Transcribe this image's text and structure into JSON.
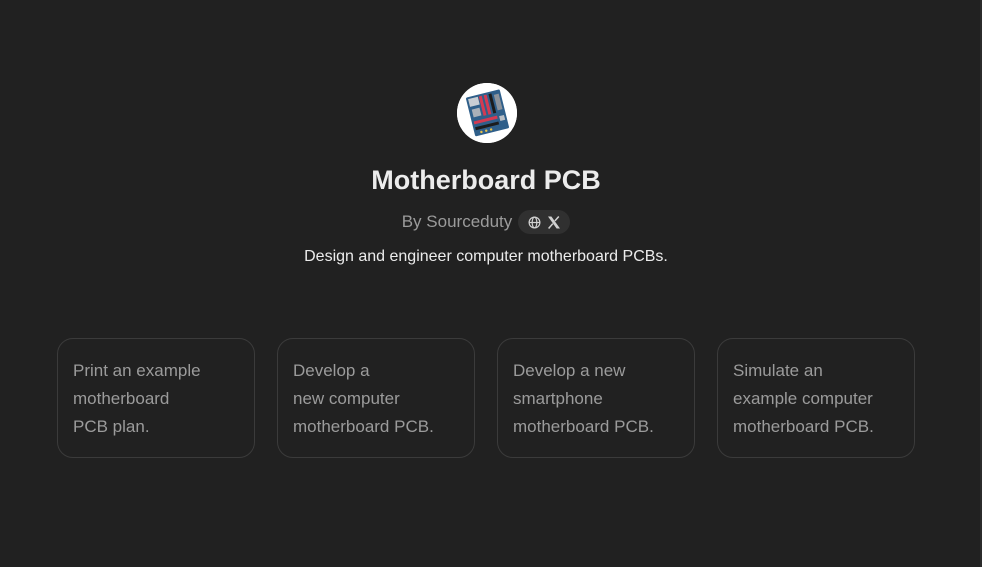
{
  "gpt": {
    "avatar_icon": "motherboard-image",
    "name": "Motherboard PCB",
    "author": "By Sourceduty",
    "links": [
      {
        "icon": "globe-icon"
      },
      {
        "icon": "x-logo-icon"
      }
    ],
    "description": "Design and engineer computer motherboard PCBs."
  },
  "conversation_starters": [
    {
      "text": "Print an example\nmotherboard\nPCB plan."
    },
    {
      "text": "Develop a\nnew computer\nmotherboard PCB."
    },
    {
      "text": "Develop a new\nsmartphone\nmotherboard PCB."
    },
    {
      "text": "Simulate an\nexample computer\nmotherboard PCB."
    }
  ],
  "colors": {
    "background": "#212121",
    "title": "#ececec",
    "muted_text": "#9b9b9b",
    "card_border": "#3b3b3b",
    "pill_background": "#303030"
  }
}
